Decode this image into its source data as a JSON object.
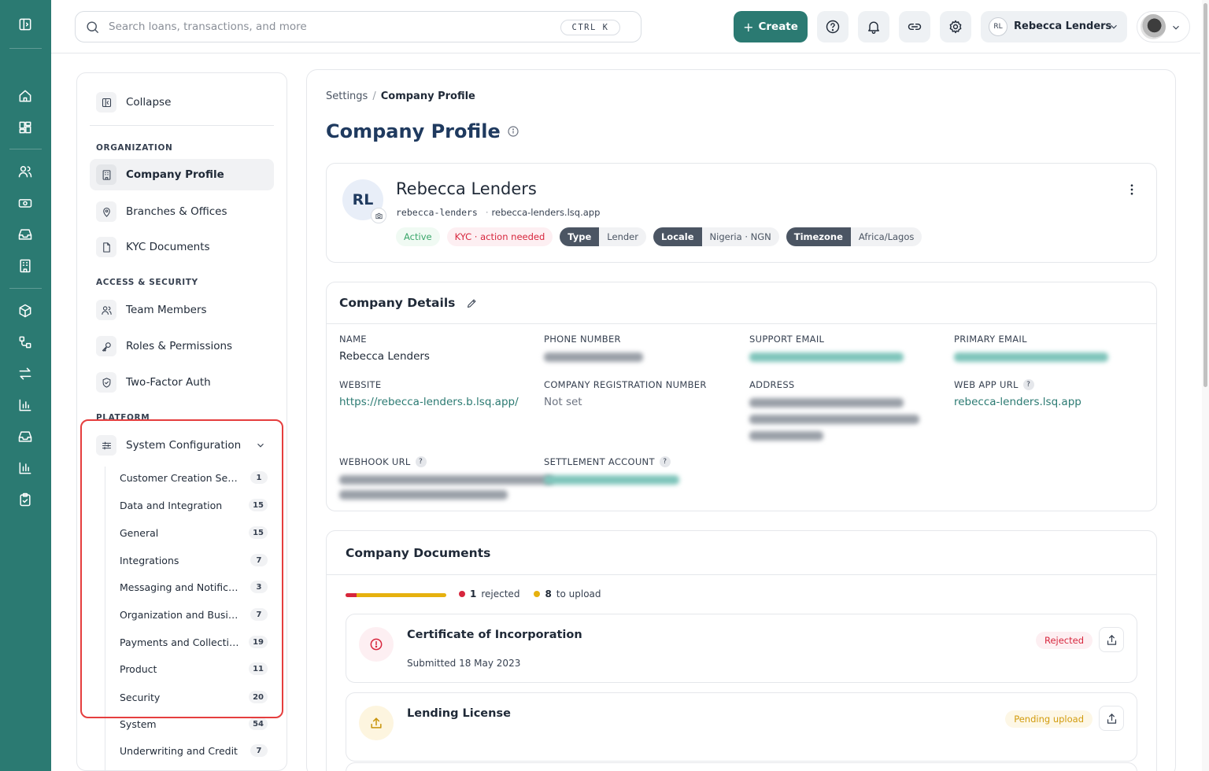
{
  "header": {
    "search_placeholder": "Search loans, transactions, and more",
    "shortcut": "CTRL K",
    "create_label": "Create",
    "account_initials": "RL",
    "account_name": "Rebecca Lenders"
  },
  "sidebar": {
    "collapse_label": "Collapse",
    "sections": {
      "organization": "ORGANIZATION",
      "access": "ACCESS & SECURITY",
      "platform": "PLATFORM"
    },
    "items": [
      {
        "label": "Company Profile"
      },
      {
        "label": "Branches & Offices"
      },
      {
        "label": "KYC Documents"
      },
      {
        "label": "Team Members"
      },
      {
        "label": "Roles & Permissions"
      },
      {
        "label": "Two-Factor Auth"
      },
      {
        "label": "System Configuration"
      }
    ],
    "sub_items": [
      {
        "label": "Customer Creation Settings",
        "count": "1"
      },
      {
        "label": "Data and Integration",
        "count": "15"
      },
      {
        "label": "General",
        "count": "15"
      },
      {
        "label": "Integrations",
        "count": "7"
      },
      {
        "label": "Messaging and Notifications",
        "count": "3"
      },
      {
        "label": "Organization and Business",
        "count": "7"
      },
      {
        "label": "Payments and Collection",
        "count": "19"
      },
      {
        "label": "Product",
        "count": "11"
      },
      {
        "label": "Security",
        "count": "20"
      },
      {
        "label": "System",
        "count": "54"
      },
      {
        "label": "Underwriting and Credit",
        "count": "7"
      }
    ]
  },
  "breadcrumb": {
    "root": "Settings",
    "sep": "/",
    "current": "Company Profile"
  },
  "page_title": "Company Profile",
  "profile": {
    "initials": "RL",
    "name": "Rebecca Lenders",
    "slug": "rebecca-lenders",
    "domain": "rebecca-lenders.lsq.app",
    "status": "Active",
    "kyc": "KYC · action needed",
    "type_key": "Type",
    "type_val": "Lender",
    "locale_key": "Locale",
    "locale_val": "Nigeria · NGN",
    "tz_key": "Timezone",
    "tz_val": "Africa/Lagos"
  },
  "details": {
    "title": "Company Details",
    "name_label": "NAME",
    "name_value": "Rebecca Lenders",
    "phone_label": "PHONE NUMBER",
    "support_label": "SUPPORT EMAIL",
    "primary_label": "PRIMARY EMAIL",
    "website_label": "WEBSITE",
    "website_value": "https://rebecca-lenders.b.lsq.app/",
    "reg_label": "COMPANY REGISTRATION NUMBER",
    "reg_value": "Not set",
    "address_label": "ADDRESS",
    "webapp_label": "WEB APP URL",
    "webapp_value": "rebecca-lenders.lsq.app",
    "webhook_label": "WEBHOOK URL",
    "settlement_label": "SETTLEMENT ACCOUNT",
    "help_glyph": "?"
  },
  "documents": {
    "title": "Company Documents",
    "rejected_count": "1",
    "rejected_label": "rejected",
    "upload_count": "8",
    "upload_label": "to upload",
    "rejected_fraction": 0.11,
    "colors": {
      "rejected": "#d7263d",
      "pending": "#e6b10f"
    },
    "items": [
      {
        "name": "Certificate of Incorporation",
        "sub": "Submitted 18 May 2023",
        "status": "Rejected"
      },
      {
        "name": "Lending License",
        "sub": "",
        "status": "Pending upload"
      }
    ]
  },
  "colors": {
    "brand": "#2b7a72",
    "title": "#1f3a5f"
  }
}
